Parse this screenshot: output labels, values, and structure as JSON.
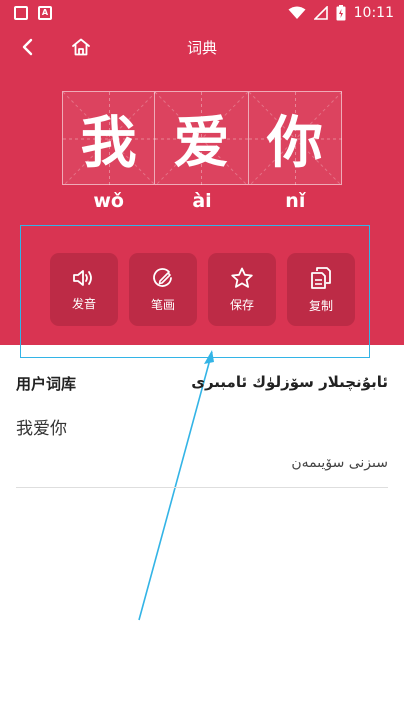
{
  "status_bar": {
    "time": "10:11"
  },
  "nav": {
    "title": "词典"
  },
  "characters": [
    "我",
    "爱",
    "你"
  ],
  "pinyin": [
    "wǒ",
    "ài",
    "nǐ"
  ],
  "actions": [
    {
      "label": "发音",
      "icon": "speaker-icon"
    },
    {
      "label": "笔画",
      "icon": "stroke-icon"
    },
    {
      "label": "保存",
      "icon": "star-icon"
    },
    {
      "label": "复制",
      "icon": "copy-icon"
    }
  ],
  "user_dict": {
    "title": "用户词库",
    "title_ug": "ئابۇنچىلار سۆزلۈك ئامبىرى",
    "entries": [
      {
        "word": "我爱你",
        "meaning": "سىزنى سۆيىمەن"
      }
    ]
  },
  "colors": {
    "primary": "#d93452",
    "annotation": "#33b4e6"
  }
}
